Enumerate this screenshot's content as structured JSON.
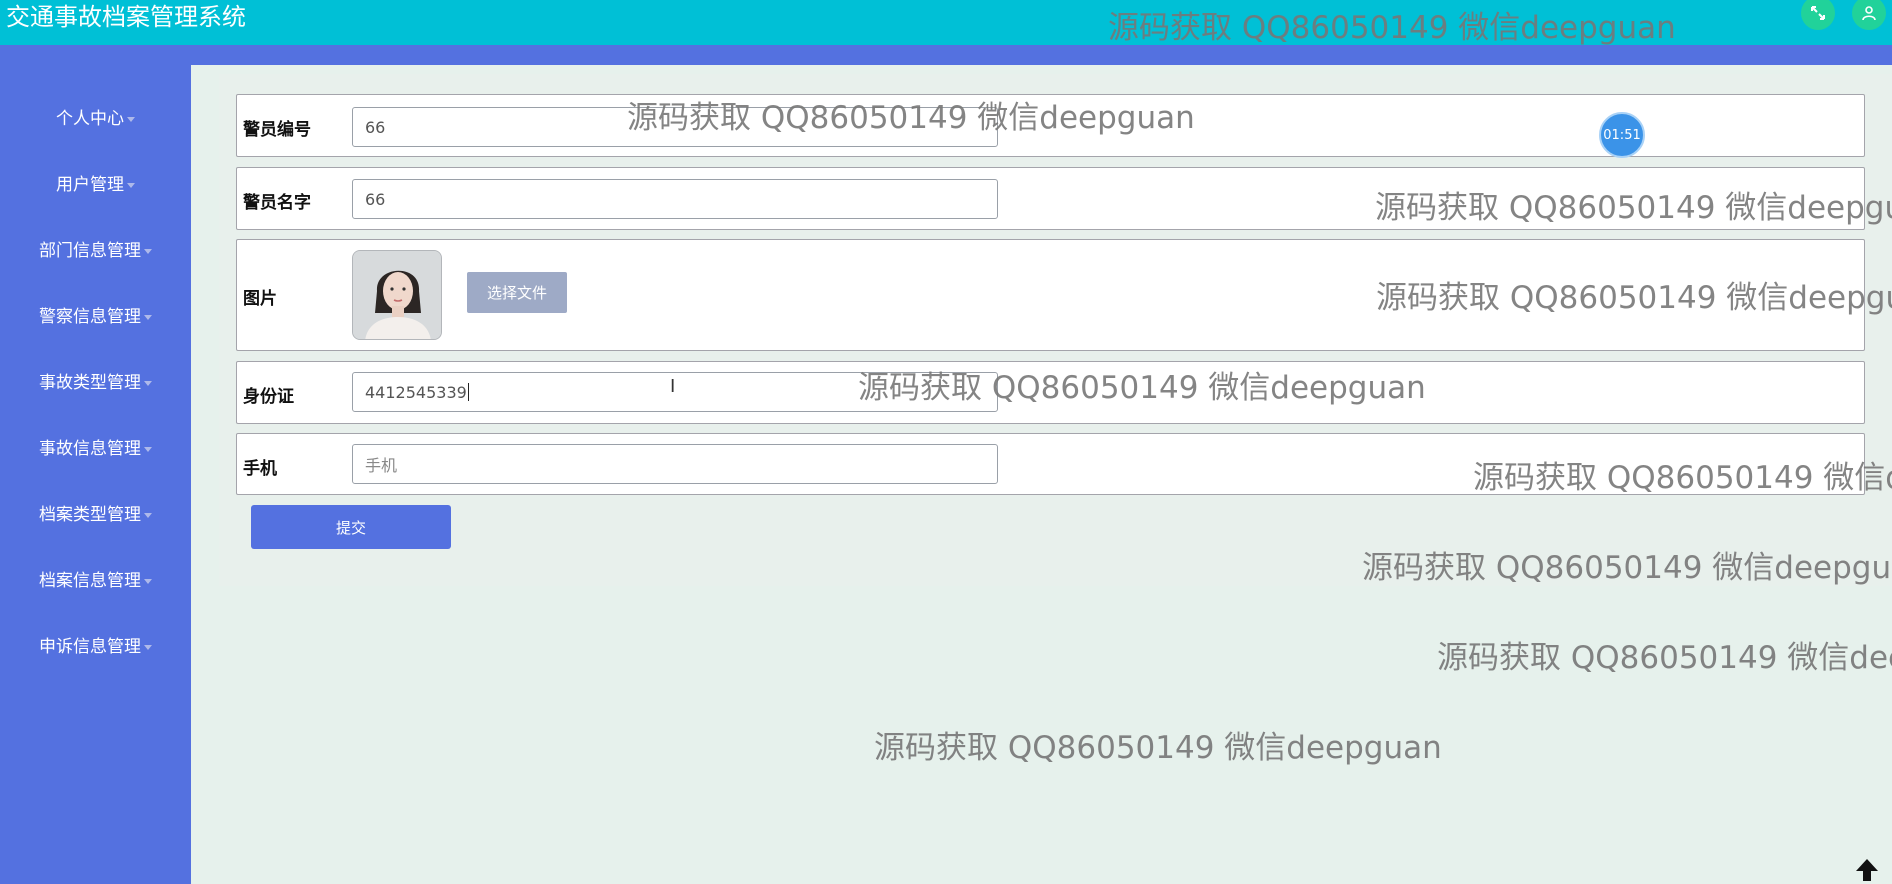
{
  "header": {
    "title": "交通事故档案管理系统",
    "icons": [
      "expand-icon",
      "user-icon"
    ]
  },
  "sidebar": {
    "items": [
      {
        "label": "个人中心"
      },
      {
        "label": "用户管理"
      },
      {
        "label": "部门信息管理"
      },
      {
        "label": "警察信息管理"
      },
      {
        "label": "事故类型管理"
      },
      {
        "label": "事故信息管理"
      },
      {
        "label": "档案类型管理"
      },
      {
        "label": "档案信息管理"
      },
      {
        "label": "申诉信息管理"
      }
    ]
  },
  "form": {
    "fields": [
      {
        "label": "警员编号",
        "value": "66"
      },
      {
        "label": "警员名字",
        "value": "66"
      },
      {
        "label": "图片",
        "button": "选择文件"
      },
      {
        "label": "身份证",
        "value": "4412545339"
      },
      {
        "label": "手机",
        "value": "",
        "placeholder": "手机"
      }
    ],
    "submit_label": "提交"
  },
  "timer": "01:51",
  "watermark": "源码获取 QQ86050149 微信deepguan",
  "colors": {
    "header": "#00c0d6",
    "sidebar": "#5471e0",
    "accent": "#5471e0",
    "background": "#e6f1ec"
  }
}
